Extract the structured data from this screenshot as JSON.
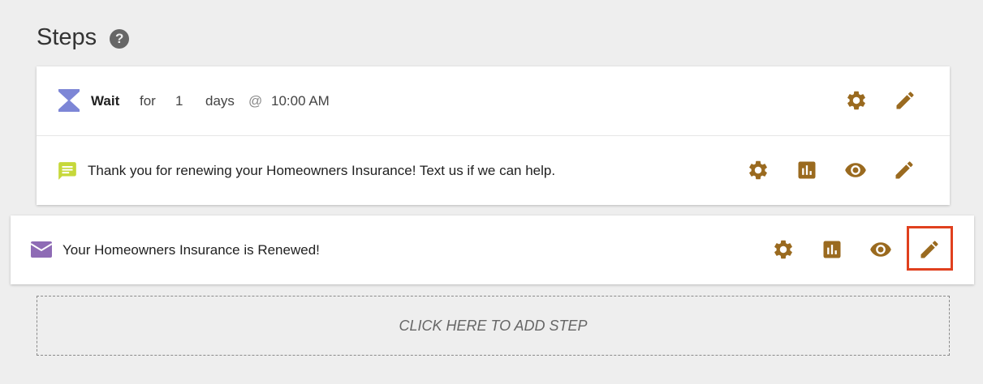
{
  "header": {
    "title": "Steps",
    "help_icon": "help-circle-icon",
    "help_symbol": "?"
  },
  "steps": [
    {
      "type": "wait",
      "icon": "hourglass-icon",
      "label": "Wait",
      "for_text": "for",
      "amount": "1",
      "unit": "days",
      "at_symbol": "@",
      "time": "10:00 AM",
      "actions": [
        "gear-icon",
        "pencil-icon"
      ]
    },
    {
      "type": "sms",
      "icon": "message-icon",
      "text": "Thank you for renewing your Homeowners Insurance! Text us if we can help.",
      "actions": [
        "gear-icon",
        "bar-chart-icon",
        "eye-icon",
        "pencil-icon"
      ]
    },
    {
      "type": "email",
      "icon": "envelope-icon",
      "text": "Your Homeowners Insurance is Renewed!",
      "actions": [
        "gear-icon",
        "bar-chart-icon",
        "eye-icon",
        "pencil-icon"
      ],
      "edit_highlighted": true
    }
  ],
  "add_step": {
    "label": "CLICK HERE TO ADD STEP"
  },
  "colors": {
    "action_icon": "#9a6a1f",
    "highlight": "#e0401e",
    "wait_icon": "#7d86d6",
    "message_icon": "#c6d83a",
    "envelope_icon": "#8e6bb5"
  }
}
